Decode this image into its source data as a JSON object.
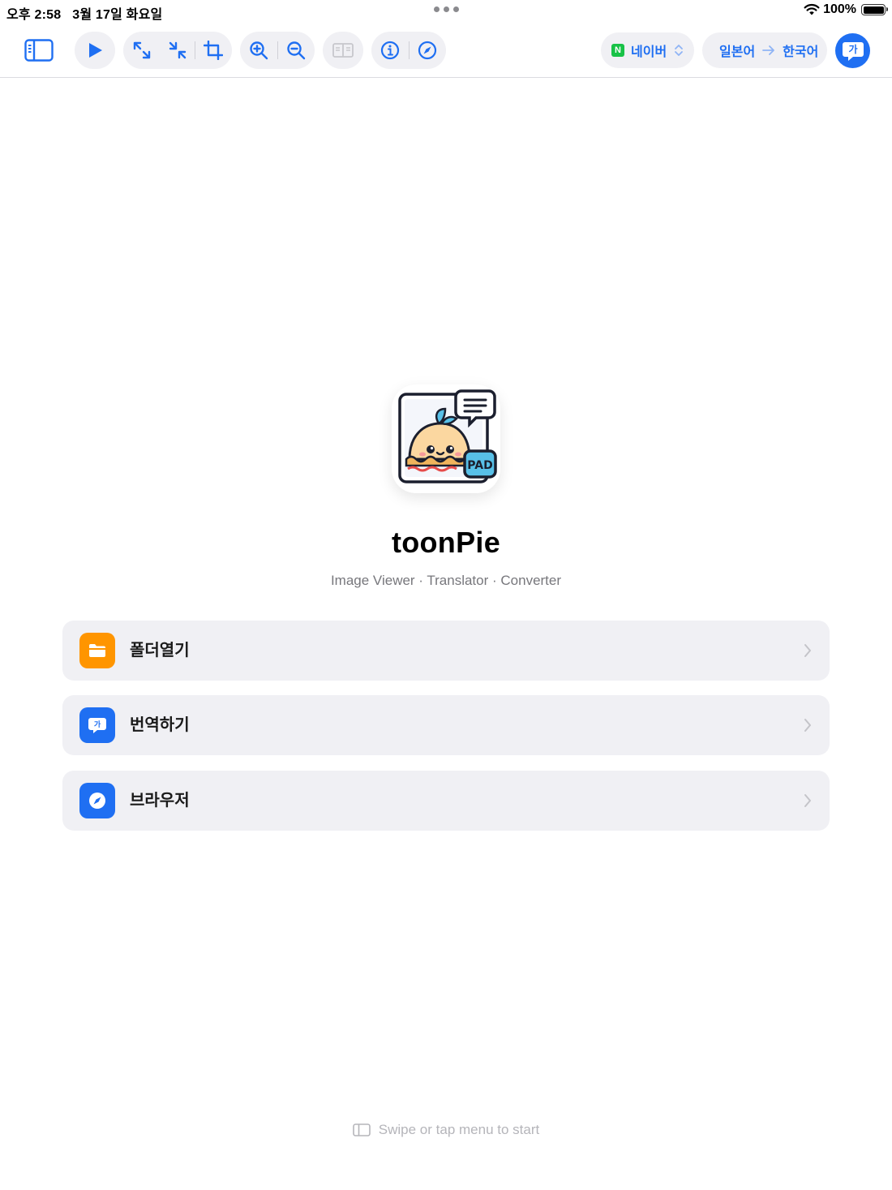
{
  "status_bar": {
    "time_date": "오후 2:58   3월 17일 화요일",
    "battery_percent": "100%"
  },
  "toolbar": {
    "icons": [
      "sidebar-icon",
      "play-icon",
      "expand-icon",
      "shrink-icon",
      "crop-icon",
      "zoom-in-icon",
      "zoom-out-icon",
      "dual-page-icon",
      "info-icon",
      "compass-icon"
    ],
    "engine": {
      "badge": "N",
      "label": "네이버"
    },
    "source_language": "일본어",
    "target_language": "한국어",
    "translate_button_label": "가"
  },
  "app": {
    "name": "toonPie",
    "tagline": "Image Viewer · Translator · Converter",
    "icon_badge": "PAD"
  },
  "menu": {
    "items": [
      {
        "label": "폴더열기",
        "icon": "folder-icon",
        "color": "#ff9500"
      },
      {
        "label": "번역하기",
        "icon": "translate-icon",
        "color": "#1f6ff2"
      },
      {
        "label": "브라우저",
        "icon": "compass-icon",
        "color": "#1f6ff2"
      }
    ]
  },
  "footer": {
    "hint": "Swipe or tap menu to start"
  },
  "colors": {
    "accent": "#1f6ff2",
    "folder": "#ff9500",
    "card_bg": "#f0f0f4",
    "naver_green": "#18c247"
  }
}
